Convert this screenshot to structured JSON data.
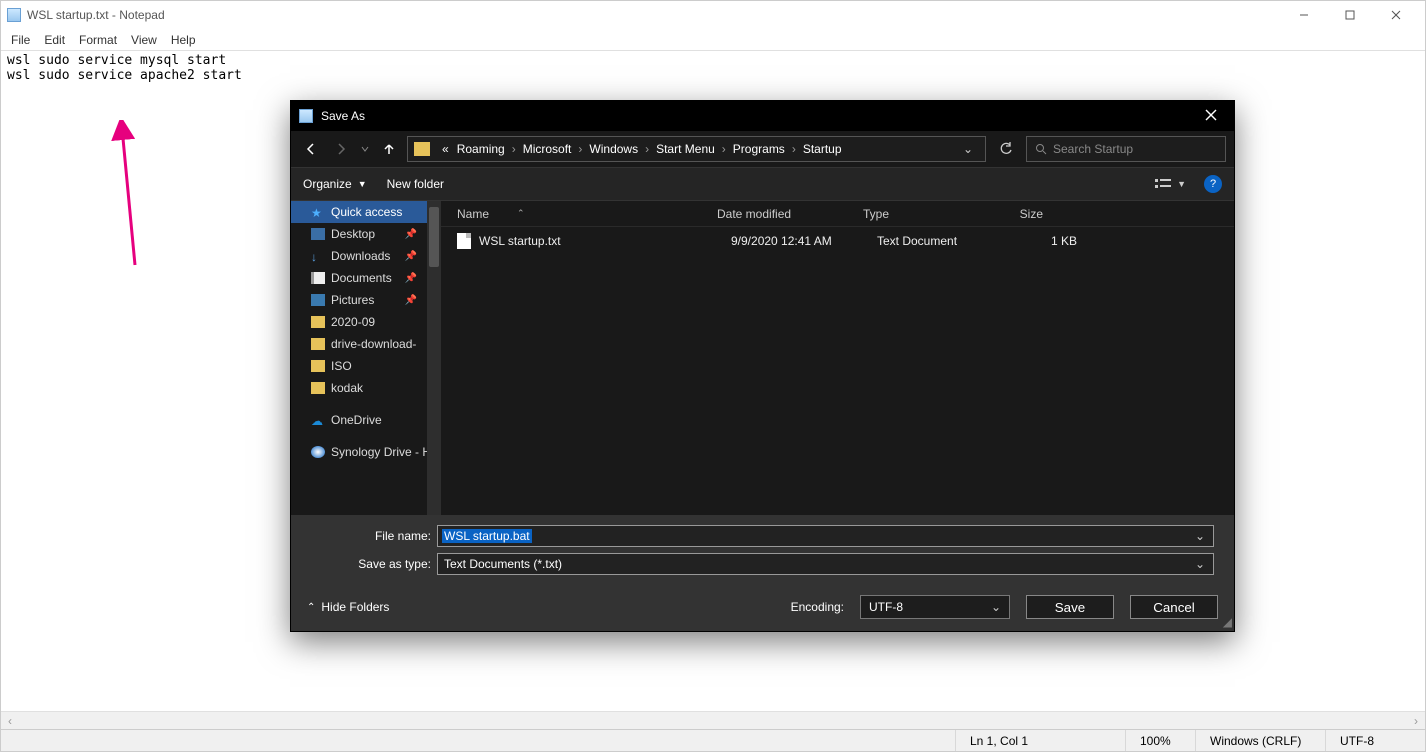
{
  "notepad": {
    "title": "WSL startup.txt - Notepad",
    "menu": [
      "File",
      "Edit",
      "Format",
      "View",
      "Help"
    ],
    "content": "wsl sudo service mysql start\nwsl sudo service apache2 start",
    "status": {
      "pos": "Ln 1, Col 1",
      "zoom": "100%",
      "eol": "Windows (CRLF)",
      "enc": "UTF-8"
    }
  },
  "saveas": {
    "title": "Save As",
    "breadcrumb_prefix": "«",
    "breadcrumb": [
      "Roaming",
      "Microsoft",
      "Windows",
      "Start Menu",
      "Programs",
      "Startup"
    ],
    "search_placeholder": "Search Startup",
    "toolbar": {
      "organize": "Organize",
      "newfolder": "New folder"
    },
    "tree": [
      {
        "label": "Quick access",
        "icon": "star",
        "active": true
      },
      {
        "label": "Desktop",
        "icon": "desktop",
        "pinned": true
      },
      {
        "label": "Downloads",
        "icon": "downloads",
        "pinned": true
      },
      {
        "label": "Documents",
        "icon": "docs",
        "pinned": true
      },
      {
        "label": "Pictures",
        "icon": "pics",
        "pinned": true
      },
      {
        "label": "2020-09",
        "icon": "folder"
      },
      {
        "label": "drive-download-",
        "icon": "folder"
      },
      {
        "label": "ISO",
        "icon": "folder"
      },
      {
        "label": "kodak",
        "icon": "folder"
      },
      {
        "label": "",
        "icon": "spacer"
      },
      {
        "label": "OneDrive",
        "icon": "cloud"
      },
      {
        "label": "",
        "icon": "spacer"
      },
      {
        "label": "Synology Drive - H",
        "icon": "syn"
      }
    ],
    "columns": {
      "name": "Name",
      "date": "Date modified",
      "type": "Type",
      "size": "Size"
    },
    "files": [
      {
        "name": "WSL startup.txt",
        "date": "9/9/2020 12:41 AM",
        "type": "Text Document",
        "size": "1 KB"
      }
    ],
    "fields": {
      "filename_label": "File name:",
      "filename_value": "WSL startup.bat",
      "savetype_label": "Save as type:",
      "savetype_value": "Text Documents (*.txt)"
    },
    "bottom": {
      "hide_folders": "Hide Folders",
      "encoding_label": "Encoding:",
      "encoding_value": "UTF-8",
      "save": "Save",
      "cancel": "Cancel"
    }
  }
}
